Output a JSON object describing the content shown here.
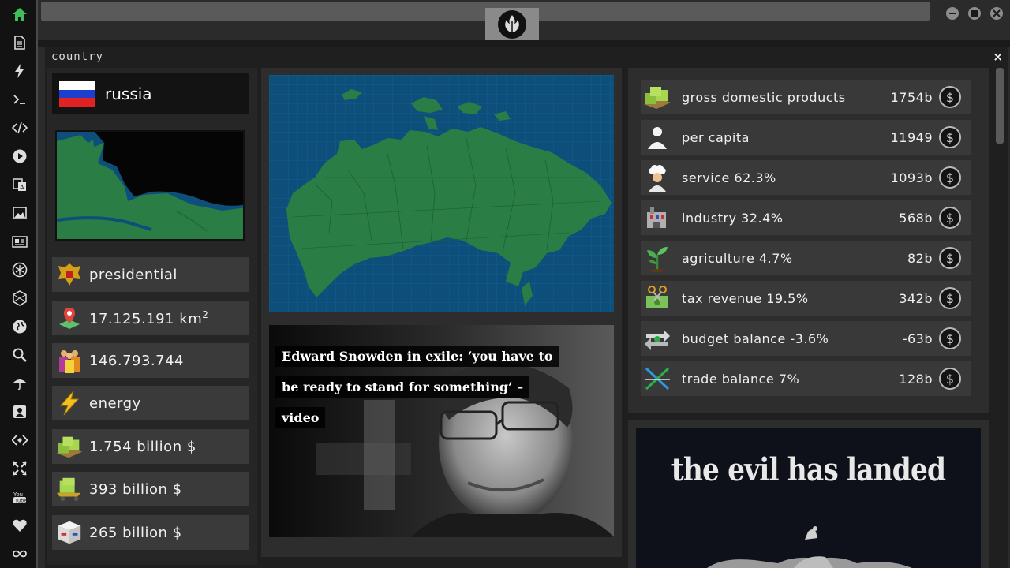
{
  "window": {
    "title": "country",
    "close_label": "×"
  },
  "country": {
    "name": "russia"
  },
  "stats": [
    {
      "icon": "coat-of-arms-icon",
      "text": "presidential"
    },
    {
      "icon": "map-pin-icon",
      "text": "17.125.191 km",
      "sup": "2"
    },
    {
      "icon": "population-icon",
      "text": "146.793.744"
    },
    {
      "icon": "lightning-icon",
      "text": "energy"
    },
    {
      "icon": "money-stack-icon",
      "text": "1.754 billion $"
    },
    {
      "icon": "money-cart-icon",
      "text": "393 billion $"
    },
    {
      "icon": "shipping-box-icon",
      "text": "265 billion $"
    }
  ],
  "economy": [
    {
      "icon": "money-stack-icon",
      "label": "gross domestic products",
      "value": "1754b"
    },
    {
      "icon": "person-icon",
      "label": "per capita",
      "value": "11949"
    },
    {
      "icon": "chef-icon",
      "label": "service 62.3%",
      "value": "1093b"
    },
    {
      "icon": "factory-icon",
      "label": "industry 32.4%",
      "value": "568b"
    },
    {
      "icon": "plant-sprout-icon",
      "label": "agriculture 4.7%",
      "value": "82b"
    },
    {
      "icon": "cash-scissors-icon",
      "label": "tax revenue 19.5%",
      "value": "342b"
    },
    {
      "icon": "exchange-arrows-icon",
      "label": "budget balance -3.6%",
      "value": "-63b"
    },
    {
      "icon": "trade-cross-icon",
      "label": "trade balance 7%",
      "value": "128b"
    }
  ],
  "currency_symbol": "$",
  "news": {
    "headline": "Edward Snowden in exile: ‘you have to be ready to stand for something’ – video"
  },
  "banner": {
    "title": "the evil has landed"
  },
  "colors": {
    "sidebar_active": "#3fbf5a",
    "land": "#2a7d45",
    "sea": "#0d4f7a",
    "panel": "#3a3a3a"
  }
}
